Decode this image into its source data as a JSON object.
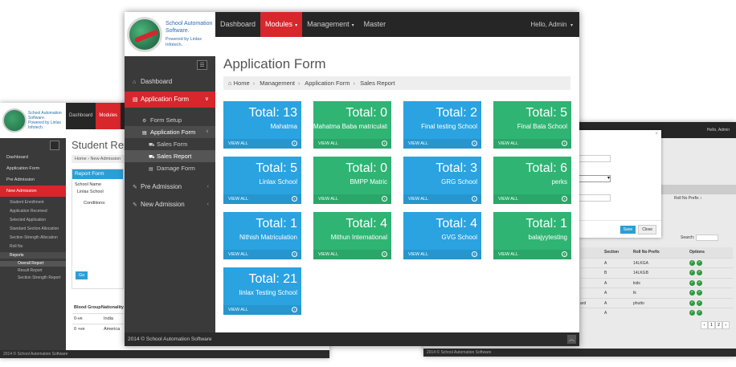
{
  "brand": {
    "name": "School Automation Software.",
    "powered_by": "Powered by Linlax Infotech."
  },
  "colors": {
    "accent_red": "#d7262c",
    "tile_blue": "#2aa3e0",
    "tile_green": "#2fb473",
    "dark_bg": "#262626",
    "sidebar_bg": "#3a3a3a"
  },
  "topnav": {
    "dashboard": "Dashboard",
    "modules": "Modules",
    "management": "Management",
    "master": "Master",
    "hello": "Hello, Admin"
  },
  "sidebar": {
    "dashboard": "Dashboard",
    "application_form": "Application Form",
    "form_setup": "Form Setup",
    "application_form_sub": "Application Form",
    "sales_form": "Sales Form",
    "sales_report": "Sales Report",
    "damage_form": "Damage Form",
    "pre_admission": "Pre Admission",
    "new_admission": "New Admission"
  },
  "page": {
    "title": "Application Form",
    "breadcrumb": [
      "Home",
      "Management",
      "Application Form",
      "Sales Report"
    ]
  },
  "tiles": [
    {
      "total": "Total: 13",
      "school": "Mahatma",
      "color": "blue",
      "footer": "VIEW ALL"
    },
    {
      "total": "Total: 0",
      "school": "Mahatma Baba matriculation School",
      "color": "green",
      "footer": "VIEW ALL"
    },
    {
      "total": "Total: 2",
      "school": "Final testing School",
      "color": "blue",
      "footer": "VIEW ALL"
    },
    {
      "total": "Total: 5",
      "school": "Final Bala School",
      "color": "green",
      "footer": "VIEW ALL"
    },
    {
      "total": "Total: 5",
      "school": "Linlax School",
      "color": "blue",
      "footer": "VIEW ALL"
    },
    {
      "total": "Total: 0",
      "school": "BMPP Matric",
      "color": "green",
      "footer": "VIEW ALL"
    },
    {
      "total": "Total: 3",
      "school": "GRG School",
      "color": "blue",
      "footer": "VIEW ALL"
    },
    {
      "total": "Total: 6",
      "school": "perks",
      "color": "green",
      "footer": "VIEW ALL"
    },
    {
      "total": "Total: 1",
      "school": "Nithish Matriculation",
      "color": "blue",
      "footer": "VIEW ALL"
    },
    {
      "total": "Total: 4",
      "school": "Mithun International",
      "color": "green",
      "footer": "VIEW ALL"
    },
    {
      "total": "Total: 4",
      "school": "GVG School",
      "color": "blue",
      "footer": "VIEW ALL"
    },
    {
      "total": "Total: 1",
      "school": "balajyytesting",
      "color": "green",
      "footer": "VIEW ALL"
    },
    {
      "total": "Total: 21",
      "school": "linlax Testing School",
      "color": "blue",
      "footer": "VIEW ALL"
    }
  ],
  "footer": {
    "text": "2014 © School Automation Software"
  },
  "left_window": {
    "brand": "School Automation Software.",
    "powered_by": "Powered by Linlax Infotech.",
    "nav_dashboard": "Dashboard",
    "nav_modules": "Modules",
    "side": [
      "Dashboard",
      "Application Form",
      "Pre Admission",
      "New Admission"
    ],
    "subs": [
      "Student Enrollment",
      "Application Received",
      "Selected Application",
      "Standard Section Allocation",
      "Section Strength Allocation",
      "Roll No",
      "Reports"
    ],
    "reports_subs": [
      "Overall Report",
      "Result Report",
      "Section Strength Report"
    ],
    "title": "Student Report",
    "crumb": "Home › New Admission",
    "panel_title": "Report Form",
    "school_name_label": "School Name",
    "school_name_value": "Linlax School",
    "conditions_label": "Conditions:",
    "go": "Go",
    "table_headers": [
      "Blood Group",
      "Nationality"
    ],
    "table_rows": [
      [
        "0-ve",
        "India"
      ],
      [
        "0 +ve",
        "America"
      ]
    ],
    "footer": "2014 © School Automation Software"
  },
  "right_window": {
    "hello": "Hello, Admin",
    "roll_prefix_header": "Roll No Prefix",
    "search_label": "Search:",
    "table_headers": [
      "",
      "Section",
      "Roll No Prefix",
      "Options"
    ],
    "table_rows": [
      [
        "",
        "A",
        "14LKGA"
      ],
      [
        "",
        "B",
        "14LKGB"
      ],
      [
        "",
        "A",
        "kids"
      ],
      [
        "",
        "A",
        "Ik"
      ],
      [
        "ard",
        "A",
        "phutto"
      ],
      [
        "",
        "A",
        ""
      ]
    ],
    "pager": [
      "‹",
      "1",
      "2",
      "›"
    ],
    "modal_save": "Save",
    "modal_close": "Close",
    "footer": "2014 © School Automation Software"
  }
}
